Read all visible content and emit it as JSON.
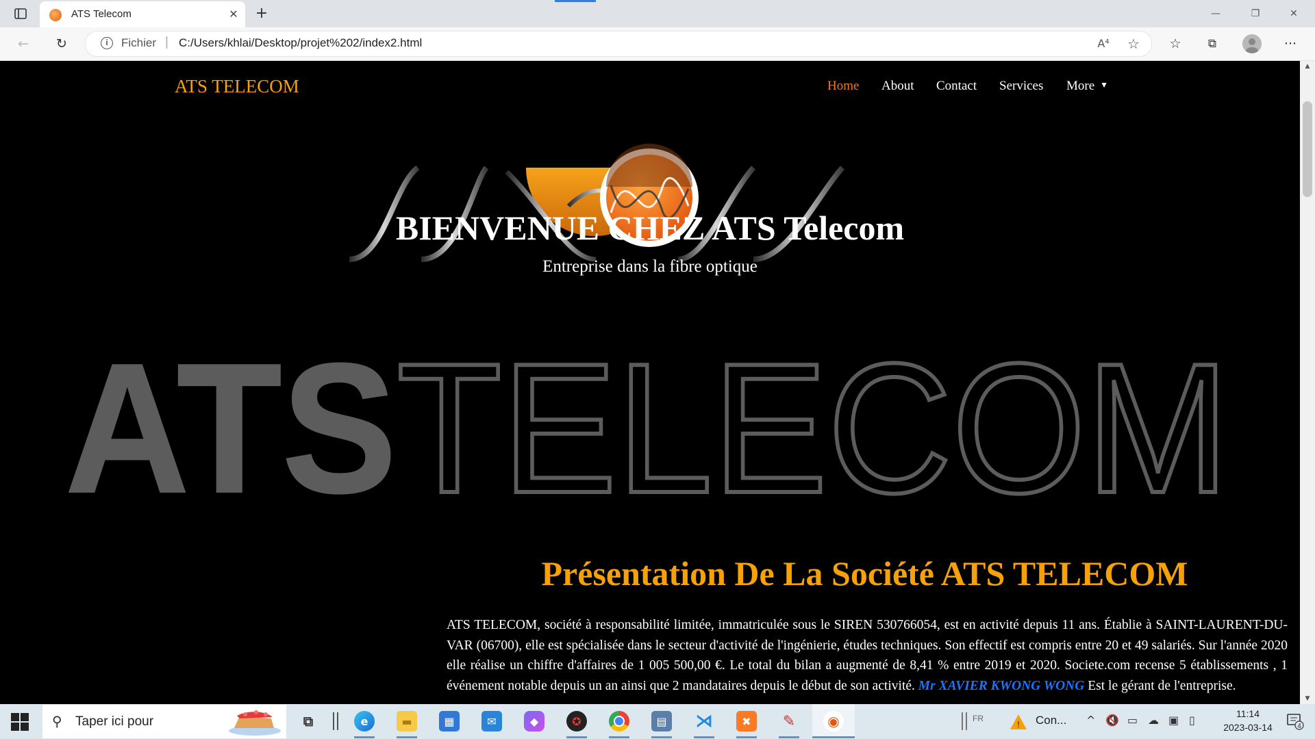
{
  "browser": {
    "tab_title": "ATS Telecom",
    "tab_close": "✕",
    "new_tab": "+",
    "address_scheme": "Fichier",
    "address_separator": "|",
    "address_url": "C:/Users/khlai/Desktop/projet%202/index2.html",
    "read_aloud": "A⁴",
    "window_controls": {
      "minimize": "—",
      "maximize": "❐",
      "close": "✕"
    },
    "icons": [
      "tab-actions-icon",
      "back-icon",
      "refresh-icon",
      "info-icon",
      "read-aloud-icon",
      "add-favorite-icon",
      "favorites-icon",
      "collections-icon",
      "profile-icon",
      "more-icon"
    ]
  },
  "page": {
    "brand": "ATS TELECOM",
    "nav": {
      "home": "Home",
      "about": "About",
      "contact": "Contact",
      "services": "Services",
      "more": "More"
    },
    "hero": {
      "title": "BIENVENUE CHEZ ATS Telecom",
      "subtitle": "Entreprise dans la fibre optique",
      "watermark": "ATSTELECOM"
    },
    "presentation": {
      "title": "Présentation De La Société ATS TELECOM",
      "text_before": "ATS TELECOM, société à responsabilité limitée, immatriculée sous le SIREN 530766054, est en activité depuis 11 ans. Établie à SAINT-LAURENT-DU-VAR (06700), elle est spécialisée dans le secteur d'activité de l'ingénierie, études techniques. Son effectif est compris entre 20 et 49 salariés. Sur l'année 2020 elle réalise un chiffre d'affaires de 1 005 500,00 €. Le total du bilan a augmenté de 8,41 % entre 2019 et 2020. Societe.com recense 5 établissements , 1 événement notable depuis un an ainsi que 2 mandataires depuis le début de son activité. ",
      "gerant": "Mr XAVIER KWONG WONG",
      "text_after": " Est le gérant de l'entreprise."
    }
  },
  "taskbar": {
    "search_placeholder": "Taper ici pour",
    "apps": [
      "task-view",
      "edge",
      "file-explorer",
      "microsoft-store",
      "mail",
      "teams",
      "antivirus",
      "chrome",
      "remote-desktop",
      "vscode",
      "xampp",
      "paint",
      "active-app"
    ],
    "tray_lang": "FR",
    "weather": "Con...",
    "time": "11:14",
    "date": "2023-03-14",
    "notification_count": "4"
  },
  "colors": {
    "accent_orange": "#f6a10a",
    "nav_active": "#f47a1f",
    "link_blue": "#1a74ff",
    "background": "#000000"
  }
}
